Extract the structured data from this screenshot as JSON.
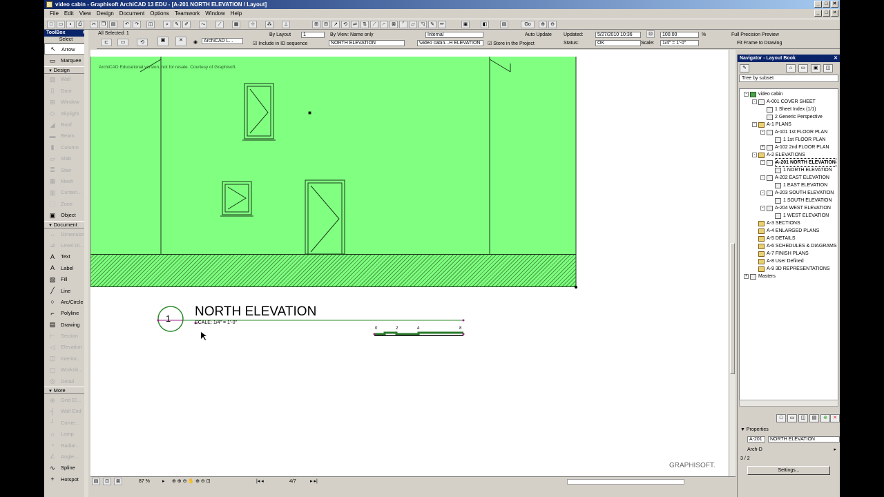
{
  "window": {
    "title": "video cabin - Graphisoft ArchiCAD 13 EDU - [A-201 NORTH ELEVATION / Layout]",
    "controls": [
      "_",
      "□",
      "✕"
    ],
    "doc_controls": [
      "_",
      "□",
      "✕"
    ]
  },
  "menu": [
    "File",
    "Edit",
    "View",
    "Design",
    "Document",
    "Options",
    "Teamwork",
    "Window",
    "Help"
  ],
  "infobox": {
    "all_selected": "All Selected: 1",
    "by_layout": "By Layout",
    "id_value": "1",
    "by_view": "By View: Name only",
    "include_seq": "Include in ID sequence",
    "view_name": "NORTH ELEVATION",
    "source": "Internal",
    "path": "\\video cabin...H ELEVATION",
    "auto_update": "Auto Update",
    "store": "Store in the Project",
    "updated_label": "Updated:",
    "updated_value": "5/27/2010 10:36",
    "status_label": "Status:",
    "status_value": "OK",
    "zoom_value": "100.00",
    "percent": "%",
    "scale_label": "Scale:",
    "scale_value": "1/4\"   =   1'-0\"",
    "full_precision": "Full Precision Preview",
    "fit_frame": "Fit Frame to Drawing",
    "archicad_layer": "ArchiCAD L..."
  },
  "toolbox": {
    "title": "ToolBox",
    "select": "Select",
    "groups": [
      {
        "label": null,
        "tools": [
          {
            "name": "Arrow",
            "icon": "↖",
            "enabled": true,
            "selected": true
          },
          {
            "name": "Marquee",
            "icon": "▭",
            "enabled": true
          }
        ]
      },
      {
        "label": "Design",
        "tools": [
          {
            "name": "Wall",
            "icon": "▨",
            "enabled": false
          },
          {
            "name": "Door",
            "icon": "▯",
            "enabled": false
          },
          {
            "name": "Window",
            "icon": "⊞",
            "enabled": false
          },
          {
            "name": "Skylight",
            "icon": "◇",
            "enabled": false
          },
          {
            "name": "Roof",
            "icon": "◢",
            "enabled": false
          },
          {
            "name": "Beam",
            "icon": "▬",
            "enabled": false
          },
          {
            "name": "Column",
            "icon": "▮",
            "enabled": false
          },
          {
            "name": "Slab",
            "icon": "▱",
            "enabled": false
          },
          {
            "name": "Stair",
            "icon": "≣",
            "enabled": false
          },
          {
            "name": "Mesh",
            "icon": "▦",
            "enabled": false
          },
          {
            "name": "Curtain...",
            "icon": "▥",
            "enabled": false
          },
          {
            "name": "Zone",
            "icon": "⬚",
            "enabled": false
          },
          {
            "name": "Object",
            "icon": "▣",
            "enabled": true
          }
        ]
      },
      {
        "label": "Document",
        "tools": [
          {
            "name": "Dimension",
            "icon": "↔",
            "enabled": false
          },
          {
            "name": "Level Di...",
            "icon": "⊿",
            "enabled": false
          },
          {
            "name": "Text",
            "icon": "A",
            "enabled": true
          },
          {
            "name": "Label",
            "icon": "A",
            "enabled": true
          },
          {
            "name": "Fill",
            "icon": "▧",
            "enabled": true
          },
          {
            "name": "Line",
            "icon": "╱",
            "enabled": true
          },
          {
            "name": "Arc/Circle",
            "icon": "○",
            "enabled": true
          },
          {
            "name": "Polyline",
            "icon": "⌐",
            "enabled": true
          },
          {
            "name": "Drawing",
            "icon": "▤",
            "enabled": true
          },
          {
            "name": "Section",
            "icon": "⊢",
            "enabled": false
          },
          {
            "name": "Elevation",
            "icon": "◁",
            "enabled": false
          },
          {
            "name": "Interior...",
            "icon": "◫",
            "enabled": false
          },
          {
            "name": "Worksh...",
            "icon": "▢",
            "enabled": false
          },
          {
            "name": "Detail",
            "icon": "◎",
            "enabled": false
          }
        ]
      },
      {
        "label": "More",
        "tools": [
          {
            "name": "Grid El...",
            "icon": "⊕",
            "enabled": false
          },
          {
            "name": "Wall End",
            "icon": "┤",
            "enabled": false
          },
          {
            "name": "Corne...",
            "icon": "┘",
            "enabled": false
          },
          {
            "name": "Lamp",
            "icon": "☼",
            "enabled": false
          },
          {
            "name": "Radial...",
            "icon": "◔",
            "enabled": false
          },
          {
            "name": "Angle...",
            "icon": "∠",
            "enabled": false
          },
          {
            "name": "Spline",
            "icon": "∿",
            "enabled": true
          },
          {
            "name": "Hotspot",
            "icon": "+",
            "enabled": true
          }
        ]
      }
    ]
  },
  "canvas": {
    "watermark": "ArchiCAD Educational version, not for resale. Courtesy of Graphisoft.",
    "title_number": "1",
    "title_text": "NORTH ELEVATION",
    "scale_text": "SCALE: 1/4\"   =    1'-0\"",
    "scalebar_labels": [
      "0",
      "2",
      "4",
      "8"
    ],
    "logo": "GRAPHISOFT.",
    "colors": {
      "fill": "#80ff80",
      "line": "#1a3a1a"
    }
  },
  "statusbar": {
    "zoom": "87 %",
    "page": "4/7"
  },
  "navigator": {
    "title": "Navigator - Layout Book",
    "mode": "Tree by subset",
    "tree": [
      {
        "level": 0,
        "label": "video cabin",
        "icon": "green",
        "exp": "-"
      },
      {
        "level": 1,
        "label": "A-001 COVER SHEET",
        "icon": "layout",
        "exp": "-"
      },
      {
        "level": 2,
        "label": "1 Sheet Index (1/1)",
        "icon": "doc",
        "exp": ""
      },
      {
        "level": 2,
        "label": "2 Generic Perspective",
        "icon": "doc",
        "exp": ""
      },
      {
        "level": 1,
        "label": "A-1 PLANS",
        "icon": "folder",
        "exp": "-"
      },
      {
        "level": 2,
        "label": "A-101 1st FLOOR PLAN",
        "icon": "layout",
        "exp": "-"
      },
      {
        "level": 3,
        "label": "1 1st FLOOR PLAN",
        "icon": "doc",
        "exp": ""
      },
      {
        "level": 2,
        "label": "A-102 2nd FLOOR PLAN",
        "icon": "layout",
        "exp": "+"
      },
      {
        "level": 1,
        "label": "A-2 ELEVATIONS",
        "icon": "folder",
        "exp": "-"
      },
      {
        "level": 2,
        "label": "A-201 NORTH ELEVATION",
        "icon": "layout",
        "exp": "-",
        "selected": true
      },
      {
        "level": 3,
        "label": "1 NORTH ELEVATION",
        "icon": "doc",
        "exp": ""
      },
      {
        "level": 2,
        "label": "A-202 EAST ELEVATION",
        "icon": "layout",
        "exp": "-"
      },
      {
        "level": 3,
        "label": "1 EAST ELEVATION",
        "icon": "doc",
        "exp": ""
      },
      {
        "level": 2,
        "label": "A-203 SOUTH ELEVATION",
        "icon": "layout",
        "exp": "-"
      },
      {
        "level": 3,
        "label": "1 SOUTH ELEVATION",
        "icon": "doc",
        "exp": ""
      },
      {
        "level": 2,
        "label": "A-204 WEST ELEVATION",
        "icon": "layout",
        "exp": "-"
      },
      {
        "level": 3,
        "label": "1 WEST ELEVATION",
        "icon": "doc",
        "exp": ""
      },
      {
        "level": 1,
        "label": "A-3 SECTIONS",
        "icon": "folder",
        "exp": ""
      },
      {
        "level": 1,
        "label": "A-4 ENLARGED PLANS",
        "icon": "folder",
        "exp": ""
      },
      {
        "level": 1,
        "label": "A-5 DETAILS",
        "icon": "folder",
        "exp": ""
      },
      {
        "level": 1,
        "label": "A-6 SCHEDULES & DIAGRAMS",
        "icon": "folder",
        "exp": ""
      },
      {
        "level": 1,
        "label": "A-7 FINISH PLANS",
        "icon": "folder",
        "exp": ""
      },
      {
        "level": 1,
        "label": "A-8 User Defined",
        "icon": "folder",
        "exp": ""
      },
      {
        "level": 1,
        "label": "A-9 3D REPRESENTATIONS",
        "icon": "folder",
        "exp": ""
      },
      {
        "level": 0,
        "label": "Masters",
        "icon": "doc",
        "exp": "+"
      }
    ],
    "properties_label": "Properties",
    "prop_id": "A-201",
    "prop_name": "NORTH ELEVATION",
    "prop_size": "Arch-D",
    "prop_count": "3 / 2",
    "settings_label": "Settings..."
  }
}
